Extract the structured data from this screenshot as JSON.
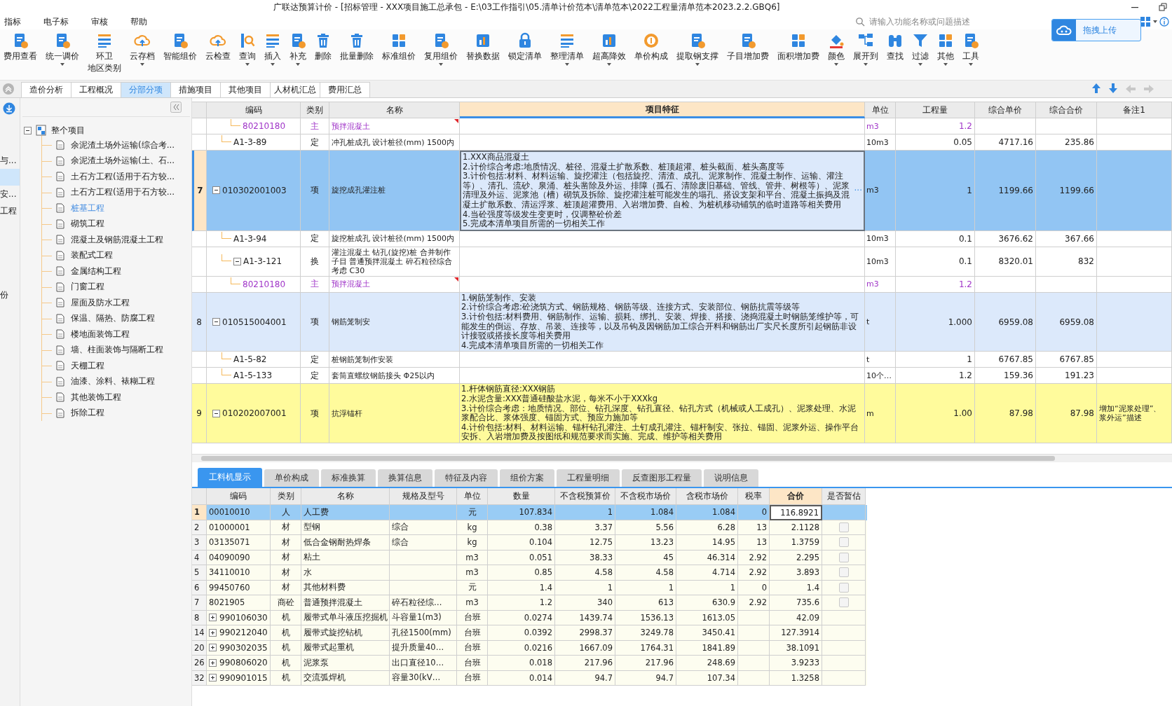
{
  "window": {
    "title": "广联达预算计价 - [招标管理 - XXX项目施工总承包 - E:\\03工作指引\\05.清单计价范本\\清单范本\\2022工程量清单范本2023.2.2.GBQ6]"
  },
  "menu": [
    "指标",
    "电子标",
    "审核",
    "帮助"
  ],
  "search": {
    "placeholder": "请输入功能名称或问题描述"
  },
  "upload_button": "拖拽上传",
  "toolbar": [
    {
      "label": "费用查看",
      "dropdown": false
    },
    {
      "label": "统一调价",
      "dropdown": true
    },
    {
      "lines": [
        "环卫",
        "地区类别"
      ],
      "dropdown": false
    },
    {
      "label": "云存档",
      "dropdown": true
    },
    {
      "label": "智能组价",
      "dropdown": false
    },
    {
      "label": "云检查",
      "dropdown": false
    },
    {
      "label": "查询",
      "dropdown": true
    },
    {
      "label": "插入",
      "dropdown": true
    },
    {
      "label": "补充",
      "dropdown": true
    },
    {
      "label": "删除",
      "dropdown": false
    },
    {
      "label": "批量删除",
      "dropdown": false
    },
    {
      "label": "标准组价",
      "dropdown": false
    },
    {
      "label": "复用组价",
      "dropdown": true
    },
    {
      "label": "替换数据",
      "dropdown": false
    },
    {
      "label": "锁定清单",
      "dropdown": false
    },
    {
      "label": "整理清单",
      "dropdown": true
    },
    {
      "label": "超高降效",
      "dropdown": true
    },
    {
      "label": "单价构成",
      "dropdown": false
    },
    {
      "label": "提取钢支撑",
      "dropdown": true
    },
    {
      "label": "子目增加费",
      "dropdown": false
    },
    {
      "label": "面积增加费",
      "dropdown": false
    },
    {
      "label": "颜色",
      "dropdown": true
    },
    {
      "label": "展开到",
      "dropdown": true
    },
    {
      "label": "查找",
      "dropdown": false
    },
    {
      "label": "过滤",
      "dropdown": true
    },
    {
      "label": "其他",
      "dropdown": true
    },
    {
      "label": "工具",
      "dropdown": true
    }
  ],
  "tabs": [
    {
      "label": "造价分析",
      "selected": false
    },
    {
      "label": "工程概况",
      "selected": false
    },
    {
      "label": "分部分项",
      "selected": true
    },
    {
      "label": "措施项目",
      "selected": false
    },
    {
      "label": "其他项目",
      "selected": false
    },
    {
      "label": "人材机汇总",
      "selected": false
    },
    {
      "label": "费用汇总",
      "selected": false
    }
  ],
  "side_panel": {
    "items": [
      {
        "label": "与...",
        "selected": false
      },
      {
        "selected": true
      },
      {
        "label": "安...",
        "selected": false
      },
      {
        "label": "工程",
        "selected": false
      },
      {
        "selected": false
      },
      {
        "selected": false
      },
      {
        "selected": false
      },
      {
        "selected": false
      },
      {
        "label": "份",
        "selected": false
      }
    ]
  },
  "tree": {
    "label": "整个项目",
    "expanded": true,
    "children": [
      {
        "label": "余泥渣土场外运输(综合考...",
        "selected": false
      },
      {
        "label": "余泥渣土场外运输(土、石...",
        "selected": false
      },
      {
        "label": "土石方工程(适用于石方较...",
        "selected": false
      },
      {
        "label": "土石方工程(适用于石方较...",
        "selected": false
      },
      {
        "label": "桩基工程",
        "selected": true
      },
      {
        "label": "砌筑工程",
        "selected": false
      },
      {
        "label": "混凝土及钢筋混凝土工程",
        "selected": false
      },
      {
        "label": "装配式工程",
        "selected": false
      },
      {
        "label": "金属结构工程",
        "selected": false
      },
      {
        "label": "门窗工程",
        "selected": false
      },
      {
        "label": "屋面及防水工程",
        "selected": false
      },
      {
        "label": "保温、隔热、防腐工程",
        "selected": false
      },
      {
        "label": "楼地面装饰工程",
        "selected": false
      },
      {
        "label": "墙、柱面装饰与隔断工程",
        "selected": false
      },
      {
        "label": "天棚工程",
        "selected": false
      },
      {
        "label": "油漆、涂料、裱糊工程",
        "selected": false
      },
      {
        "label": "其他装饰工程",
        "selected": false
      },
      {
        "label": "拆除工程",
        "selected": false
      }
    ]
  },
  "upper_table": {
    "columns": [
      {
        "label": "编码",
        "selected": false
      },
      {
        "label": "类别",
        "selected": false
      },
      {
        "label": "名称",
        "selected": false
      },
      {
        "label": "项目特征",
        "selected": true
      },
      {
        "label": "单位",
        "selected": false
      },
      {
        "label": "工程量",
        "selected": false
      },
      {
        "label": "综合单价",
        "selected": false
      },
      {
        "label": "综合合价",
        "selected": false
      },
      {
        "label": "备注1",
        "selected": false
      }
    ],
    "rows": [
      {
        "kind": "offscreen",
        "children": [
          {
            "kind": "offscreen",
            "children": [
              {
                "kind": "material",
                "code": "80210180",
                "type": "主",
                "name": "预拌混凝土",
                "unit": "m3",
                "quantity": "1.2",
                "note_mark": true,
                "selected": false
              }
            ]
          },
          {
            "kind": "quota",
            "code": "A1-3-89",
            "type": "定",
            "name": "冲孔桩成孔 设计桩径(mm) 1500内",
            "unit": "10m3",
            "quantity": "0.05",
            "unit_price": "4717.16",
            "total": "235.86",
            "selected": false
          }
        ]
      },
      {
        "kind": "item",
        "num": "7",
        "code": "010302001003",
        "type": "项",
        "name": "旋挖成孔灌注桩",
        "color": "#dce9fb",
        "selected": true,
        "expanded": true,
        "edit_button": "···",
        "unit": "m3",
        "quantity": "1",
        "unit_price": "1199.66",
        "total": "1199.66",
        "features": [
          "1.XXX商品混凝土",
          "2.计价综合考虑:地质情况、桩径、混凝土扩散系数、桩顶超灌、桩头截面、桩头高度等",
          "3.计价包括:材料、材料运输、旋挖灌注（包括旋挖、清渣、成孔、泥浆制作、混凝土制作、运输、灌注等）、清孔、流砂、泉涌、桩头凿除及外运、排障（孤石、清除废旧基础、管线、管井、树根等）、泥浆清理及外运、泥浆池（槽）砌筑及拆除、旋挖灌注桩可能发生的塌孔、搭设支架和平台、混凝土振捣及混凝土扩散系数、清运浮浆、桩顶超灌费用、入岩增加费、自检、为桩机移动铺筑的临时道路等相关费用",
          "4.当砼强度等级发生变更时，仅调整砼价差",
          "5.完成本清单项目所需的一切相关工作"
        ],
        "children": [
          {
            "kind": "quota",
            "code": "A1-3-94",
            "type": "定",
            "name": "旋挖桩成孔 设计桩径(mm) 1500内",
            "unit": "10m3",
            "quantity": "0.1",
            "unit_price": "3676.62",
            "total": "367.66",
            "selected": false
          },
          {
            "kind": "quota",
            "code": "A1-3-121",
            "type": "换",
            "name": "灌注混凝土 钻孔(旋挖)桩 合并制作子目 普通预拌混凝土 碎石粒径综合考虑 C30",
            "unit": "10m3",
            "quantity": "0.1",
            "unit_price": "8320.01",
            "total": "832",
            "selected": false,
            "expanded": true,
            "children": [
              {
                "kind": "material",
                "code": "80210180",
                "type": "主",
                "name": "预拌混凝土",
                "unit": "m3",
                "quantity": "1.2",
                "note_mark": true,
                "selected": false
              }
            ]
          }
        ]
      },
      {
        "kind": "item",
        "num": "8",
        "code": "010515004001",
        "type": "项",
        "name": "钢筋笼制安",
        "color": "#dce9fb",
        "selected": false,
        "expanded": true,
        "unit": "t",
        "quantity": "1.000",
        "unit_price": "6959.08",
        "total": "6959.08",
        "features": [
          "1.钢筋笼制作、安装",
          "2.计价综合考虑:砼浇筑方式、钢筋规格、钢筋等级、连接方式、安装部位、钢筋抗震等级等",
          "3.计价包括:材料费用、钢筋制作、运输、损耗、绑扎、安装、焊接、搭接、浇捣混凝土时钢筋笼维护等，可能发生的倒运、存放、吊装、连接等，以及吊钩及因钢筋加工综合开料和钢筋出厂实尺长度所引起钢筋非设计接驳或搭接长度等相关费用",
          "4.完成本清单项目所需的一切相关工作"
        ],
        "children": [
          {
            "kind": "quota",
            "code": "A1-5-82",
            "type": "定",
            "name": "桩钢筋笼制作安装",
            "unit": "t",
            "quantity": "1",
            "unit_price": "6767.85",
            "total": "6767.85",
            "selected": false
          },
          {
            "kind": "quota",
            "code": "A1-5-133",
            "type": "定",
            "name": "套筒直螺纹钢筋接头 Φ25以内",
            "unit": "10个…",
            "quantity": "1.2",
            "unit_price": "159.36",
            "total": "191.23",
            "selected": false
          }
        ]
      },
      {
        "kind": "item",
        "num": "9",
        "code": "010202007001",
        "type": "项",
        "name": "抗浮锚杆",
        "color": "#fffb9c",
        "selected": false,
        "expanded": true,
        "unit": "m",
        "quantity": "1.00",
        "unit_price": "87.98",
        "total": "87.98",
        "remark": [
          "增加“泥浆处理”、",
          "浆外运”描述"
        ],
        "features": [
          "1.杆体钢筋直径:XXX钢筋",
          "2.水泥含量:XXX普通硅酸盐水泥，每米不小于XXXkg",
          "3.计价综合考虑：地质情况、部位、钻孔深度、钻孔直径、钻孔方式（机械或人工成孔）、泥浆处理、水泥浆配合比、浆体强度、锚固方式、预应力施加等",
          "4.计价包括:材料、材料运输、锚杆钻孔灌注、土钉成孔灌注、锚杆制安、张拉、锚固、泥浆外运、操作平台安拆、入岩增加费及按图纸和规范要求而实施、完成、维护等相关费用"
        ]
      }
    ]
  },
  "detail_tabs": [
    {
      "label": "工料机显示",
      "selected": true
    },
    {
      "label": "单价构成",
      "selected": false
    },
    {
      "label": "标准换算",
      "selected": false
    },
    {
      "label": "换算信息",
      "selected": false
    },
    {
      "label": "特征及内容",
      "selected": false
    },
    {
      "label": "组价方案",
      "selected": false
    },
    {
      "label": "工程量明细",
      "selected": false
    },
    {
      "label": "反查图形工程量",
      "selected": false
    },
    {
      "label": "说明信息",
      "selected": false
    }
  ],
  "detail_table": {
    "columns": [
      {
        "label": "编码",
        "selected": false
      },
      {
        "label": "类别",
        "selected": false
      },
      {
        "label": "名称",
        "selected": false
      },
      {
        "label": "规格及型号",
        "selected": false
      },
      {
        "label": "单位",
        "selected": false
      },
      {
        "label": "数量",
        "selected": false
      },
      {
        "label": "不含税预算价",
        "selected": false
      },
      {
        "label": "不含税市场价",
        "selected": false
      },
      {
        "label": "含税市场价",
        "selected": false
      },
      {
        "label": "税率",
        "selected": false
      },
      {
        "label": "合价",
        "selected": true
      },
      {
        "label": "是否暂估",
        "selected": false
      }
    ],
    "rows": [
      {
        "kind": "labor",
        "num": "1",
        "code": "00010010",
        "type": "人",
        "name": "人工费",
        "unit": "元",
        "quantity": "107.834",
        "budget_price": "1",
        "market_price": "1.084",
        "market_price_tax": "1.084",
        "tax_rate": "0",
        "total": "116.8921",
        "selected": true
      },
      {
        "kind": "material",
        "num": "2",
        "code": "01000001",
        "type": "材",
        "name": "型钢",
        "spec": "综合",
        "unit": "kg",
        "quantity": "0.38",
        "budget_price": "3.37",
        "market_price": "5.56",
        "market_price_tax": "6.28",
        "tax_rate": "13",
        "total": "2.1128",
        "selected": false,
        "provisional": false
      },
      {
        "kind": "material",
        "num": "3",
        "code": "03135071",
        "type": "材",
        "name": "低合金钢耐热焊条",
        "spec": "综合",
        "unit": "kg",
        "quantity": "0.104",
        "budget_price": "12.75",
        "market_price": "13.23",
        "market_price_tax": "14.95",
        "tax_rate": "13",
        "total": "1.3759",
        "selected": false,
        "provisional": false
      },
      {
        "kind": "material",
        "num": "4",
        "code": "04090090",
        "type": "材",
        "name": "粘土",
        "unit": "m3",
        "quantity": "0.051",
        "budget_price": "38.33",
        "market_price": "45",
        "market_price_tax": "46.314",
        "tax_rate": "2.92",
        "total": "2.295",
        "selected": false,
        "provisional": false
      },
      {
        "kind": "material",
        "num": "5",
        "code": "34110010",
        "type": "材",
        "name": "水",
        "unit": "m3",
        "quantity": "0.85",
        "budget_price": "4.58",
        "market_price": "4.58",
        "market_price_tax": "4.714",
        "tax_rate": "2.92",
        "total": "3.893",
        "selected": false,
        "provisional": false
      },
      {
        "kind": "material",
        "num": "6",
        "code": "99450760",
        "type": "材",
        "name": "其他材料费",
        "unit": "元",
        "quantity": "1.4",
        "budget_price": "1",
        "market_price": "1",
        "market_price_tax": "1",
        "tax_rate": "0",
        "total": "1.4",
        "selected": false,
        "provisional": false
      },
      {
        "kind": "material",
        "num": "7",
        "code": "8021905",
        "type": "商砼",
        "name": "普通预拌混凝土",
        "spec": "碎石粒径综…",
        "unit": "m3",
        "quantity": "1.2",
        "budget_price": "340",
        "market_price": "613",
        "market_price_tax": "630.9",
        "tax_rate": "2.92",
        "total": "735.6",
        "selected": false,
        "provisional": false
      },
      {
        "kind": "machine",
        "num": "8",
        "code": "990106030",
        "type": "机",
        "name": "履带式单斗液压挖掘机",
        "spec": "斗容量1(m3)",
        "unit": "台班",
        "quantity": "0.0274",
        "budget_price": "1439.74",
        "market_price": "1536.13",
        "market_price_tax": "1613.05",
        "total": "42.09",
        "selected": false,
        "expanded": false
      },
      {
        "kind": "machine",
        "num": "14",
        "code": "990212040",
        "type": "机",
        "name": "履带式旋挖钻机",
        "spec": "孔径1500(mm)",
        "unit": "台班",
        "quantity": "0.0392",
        "budget_price": "2998.37",
        "market_price": "3249.78",
        "market_price_tax": "3450.41",
        "total": "127.3914",
        "selected": false,
        "expanded": false
      },
      {
        "kind": "machine",
        "num": "20",
        "code": "990302035",
        "type": "机",
        "name": "履带式起重机",
        "spec": "提升质量40…",
        "unit": "台班",
        "quantity": "0.0216",
        "budget_price": "1667.09",
        "market_price": "1764.31",
        "market_price_tax": "1841.89",
        "total": "38.1091",
        "selected": false,
        "expanded": false
      },
      {
        "kind": "machine",
        "num": "26",
        "code": "990806020",
        "type": "机",
        "name": "泥浆泵",
        "spec": "出口直径10…",
        "unit": "台班",
        "quantity": "0.018",
        "budget_price": "217.96",
        "market_price": "217.96",
        "market_price_tax": "248.69",
        "total": "3.9233",
        "selected": false,
        "expanded": false
      },
      {
        "kind": "machine",
        "num": "32",
        "code": "990901015",
        "type": "机",
        "name": "交流弧焊机",
        "spec": "容量30(kV…",
        "unit": "台班",
        "quantity": "0.014",
        "budget_price": "94.7",
        "market_price": "94.7",
        "market_price_tax": "107.34",
        "total": "1.3258",
        "selected": false,
        "expanded": false
      }
    ]
  }
}
